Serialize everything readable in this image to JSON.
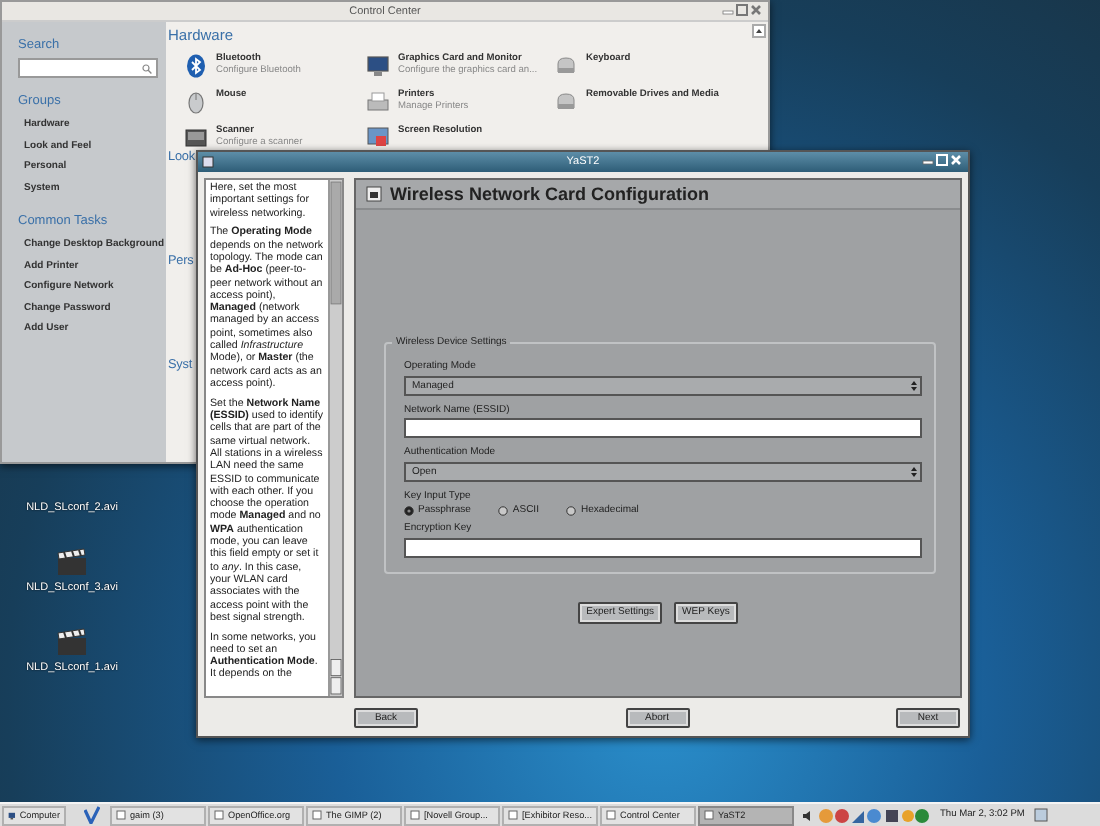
{
  "desktop_icons": [
    {
      "label": "NLD_SLconf_2.avi",
      "icon_visible": false
    },
    {
      "label": "NLD_SLconf_3.avi",
      "icon_visible": true
    },
    {
      "label": "NLD_SLconf_1.avi",
      "icon_visible": true
    }
  ],
  "control_center": {
    "title": "Control Center",
    "search_label": "Search",
    "groups_label": "Groups",
    "groups": [
      "Hardware",
      "Look and Feel",
      "Personal",
      "System"
    ],
    "common_tasks_label": "Common Tasks",
    "tasks": [
      "Change Desktop Background",
      "Add Printer",
      "Configure Network",
      "Change Password",
      "Add User"
    ],
    "sections": [
      {
        "heading": "Hardware",
        "items": [
          {
            "name": "Bluetooth",
            "description": "Configure Bluetooth"
          },
          {
            "name": "Graphics Card and Monitor",
            "description": "Configure the graphics card an..."
          },
          {
            "name": "Keyboard"
          },
          {
            "name": "Mouse"
          },
          {
            "name": "Printers",
            "description": "Manage Printers"
          },
          {
            "name": "Removable Drives and Media"
          },
          {
            "name": "Scanner",
            "description": "Configure a scanner"
          },
          {
            "name": "Screen Resolution"
          }
        ]
      },
      {
        "heading": "Look"
      },
      {
        "heading": "Pers"
      },
      {
        "heading": "Syst"
      }
    ]
  },
  "yast": {
    "title": "YaST2",
    "help": [
      "Here, set the most important settings for wireless networking.",
      "The **Operating Mode** depends on the network topology. The mode can be **Ad-Hoc** (peer-to-peer network without an access point), **Managed** (network managed by an access point, sometimes also called *Infrastructure* Mode), or **Master** (the network card acts as an access point).",
      "Set the **Network Name (ESSID)** used to identify cells that are part of the same virtual network. All stations in a wireless LAN need the same ESSID to communicate with each other. If you choose the operation mode **Managed** and no **WPA** authentication mode, you can leave this field empty or set it to *any*. In this case, your WLAN card associates with the access point with the best signal strength.",
      "In some networks, you need to set an **Authentication Mode**. It depends on the"
    ],
    "heading": "Wireless Network Card Configuration",
    "group_label": "Wireless Device Settings",
    "operating_mode": {
      "label": "Operating Mode",
      "value": "Managed"
    },
    "network_name": {
      "label": "Network Name (ESSID)"
    },
    "authentication_mode": {
      "label": "Authentication Mode",
      "value": "Open"
    },
    "key_input_type": {
      "label": "Key Input Type",
      "options": [
        {
          "label": "Passphrase",
          "selected": true
        },
        {
          "label": "ASCII",
          "selected": false
        },
        {
          "label": "Hexadecimal",
          "selected": false
        }
      ]
    },
    "encryption_key": {
      "label": "Encryption Key"
    },
    "actions": [
      "Expert Settings",
      "WEP Keys"
    ],
    "buttons": [
      "Back",
      "Abort",
      "Next"
    ]
  },
  "taskbar": {
    "menu": "Computer",
    "items": [
      {
        "label": "gaim (3)",
        "selected": false
      },
      {
        "label": "OpenOffice.org",
        "selected": false
      },
      {
        "label": "The GIMP (2)",
        "selected": false
      },
      {
        "label": "[Novell Group...",
        "selected": false
      },
      {
        "label": "[Exhibitor Reso...",
        "selected": false
      },
      {
        "label": "Control Center",
        "selected": false
      },
      {
        "label": "YaST2",
        "selected": true
      }
    ],
    "clock": "Thu Mar 2, 3:02 PM"
  }
}
